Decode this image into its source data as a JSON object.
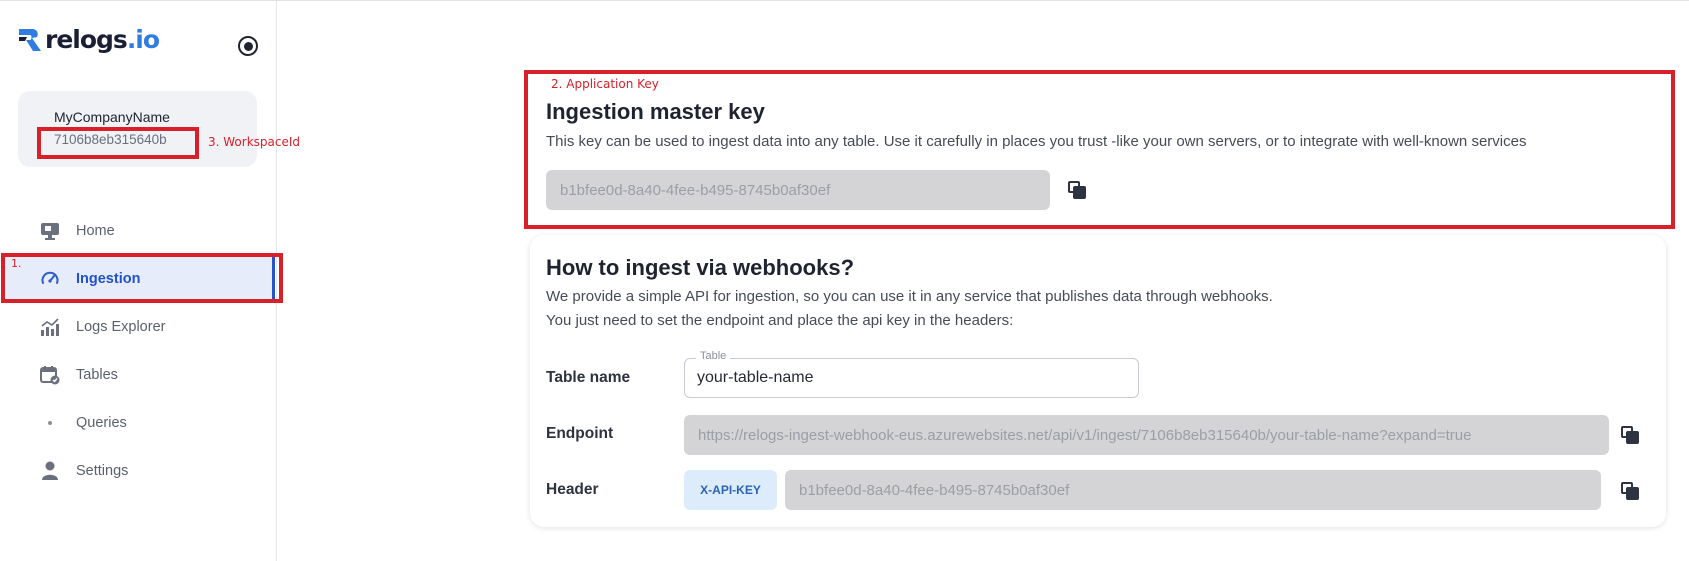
{
  "app": {
    "logo_text": "relogs",
    "logo_dot": ".io",
    "theme_toggle_icon": "radio-dot-icon"
  },
  "workspace": {
    "name": "MyCompanyName",
    "id": "7106b8eb315640b"
  },
  "nav": {
    "items": [
      {
        "label": "Home",
        "icon": "monitor-icon"
      },
      {
        "label": "Ingestion",
        "icon": "speedometer-icon",
        "active": true
      },
      {
        "label": "Logs Explorer",
        "icon": "chart-icon"
      },
      {
        "label": "Tables",
        "icon": "calendar-check-icon"
      },
      {
        "label": "Queries",
        "icon": "dot-icon"
      },
      {
        "label": "Settings",
        "icon": "person-icon"
      }
    ]
  },
  "annotations": {
    "nav_marker": "1.",
    "app_key": "2. Application Key",
    "workspace_id": "3. WorkspaceId",
    "color": "#d8202b"
  },
  "master_key": {
    "title": "Ingestion master key",
    "description": "This key can be used to ingest data into any table. Use it carefully in places you trust -like your own servers, or to integrate with well-known services",
    "value": "b1bfee0d-8a40-4fee-b495-8745b0af30ef"
  },
  "webhook": {
    "title": "How to ingest via webhooks?",
    "line1": "We provide a simple API for ingestion, so you can use it in any service that publishes data through webhooks.",
    "line2": "You just need to set the endpoint and place the api key in the headers:",
    "table_label": "Table name",
    "table_legend": "Table",
    "table_value": "your-table-name",
    "endpoint_label": "Endpoint",
    "endpoint_value": "https://relogs-ingest-webhook-eus.azurewebsites.net/api/v1/ingest/7106b8eb315640b/your-table-name?expand=true",
    "header_label": "Header",
    "header_tag": "X-API-KEY",
    "header_value": "b1bfee0d-8a40-4fee-b495-8745b0af30ef"
  },
  "colors": {
    "accent": "#2153c6",
    "active_bg": "#e7ecfb",
    "annotation": "#d8202b"
  }
}
